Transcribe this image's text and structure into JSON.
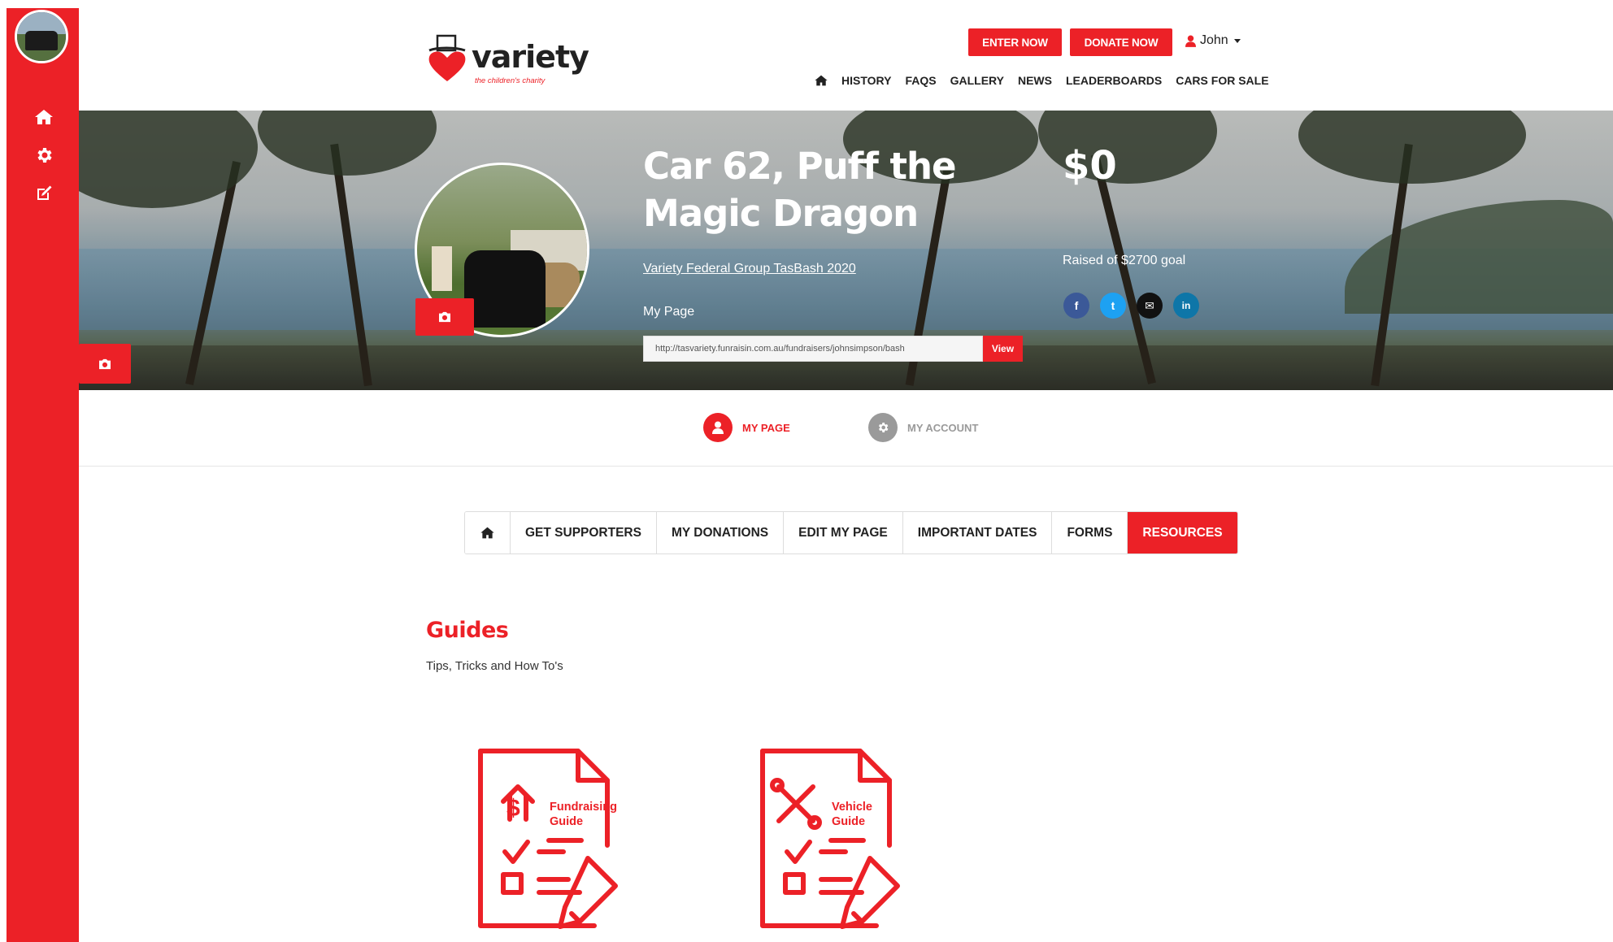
{
  "colors": {
    "brand_red": "#ec2127",
    "facebook": "#3b5998",
    "twitter": "#1da1f2",
    "email": "#111111",
    "linkedin": "#0e76a8",
    "gray": "#9a9a9a"
  },
  "sidebar": {
    "icons": [
      "home-icon",
      "gear-icon",
      "edit-icon"
    ]
  },
  "header": {
    "logo_word": "variety",
    "logo_tagline": "the children's charity",
    "enter_now": "ENTER NOW",
    "donate_now": "DONATE NOW",
    "user_name": "John",
    "nav": [
      "HISTORY",
      "FAQS",
      "GALLERY",
      "NEWS",
      "LEADERBOARDS",
      "CARS FOR SALE"
    ]
  },
  "hero": {
    "title": "Car 62, Puff the Magic Dragon",
    "event_link": "Variety Federal Group TasBash 2020",
    "my_page_label": "My Page",
    "page_url": "http://tasvariety.funraisin.com.au/fundraisers/johnsimpson/bash",
    "view_label": "View",
    "amount_raised": "$0",
    "goal_text": "Raised of $2700 goal",
    "social": [
      "f",
      "t",
      "✉",
      "in"
    ]
  },
  "switcher": {
    "my_page": "MY PAGE",
    "my_account": "MY ACCOUNT"
  },
  "tabs": [
    "GET SUPPORTERS",
    "MY DONATIONS",
    "EDIT MY PAGE",
    "IMPORTANT DATES",
    "FORMS",
    "RESOURCES"
  ],
  "active_tab": "RESOURCES",
  "content": {
    "title": "Guides",
    "subtitle": "Tips, Tricks and How To's",
    "guides": [
      {
        "label_line1": "Fundraising",
        "label_line2": "Guide",
        "icon": "fundraising-guide-icon"
      },
      {
        "label_line1": "Vehicle",
        "label_line2": "Guide",
        "icon": "vehicle-guide-icon"
      }
    ]
  }
}
